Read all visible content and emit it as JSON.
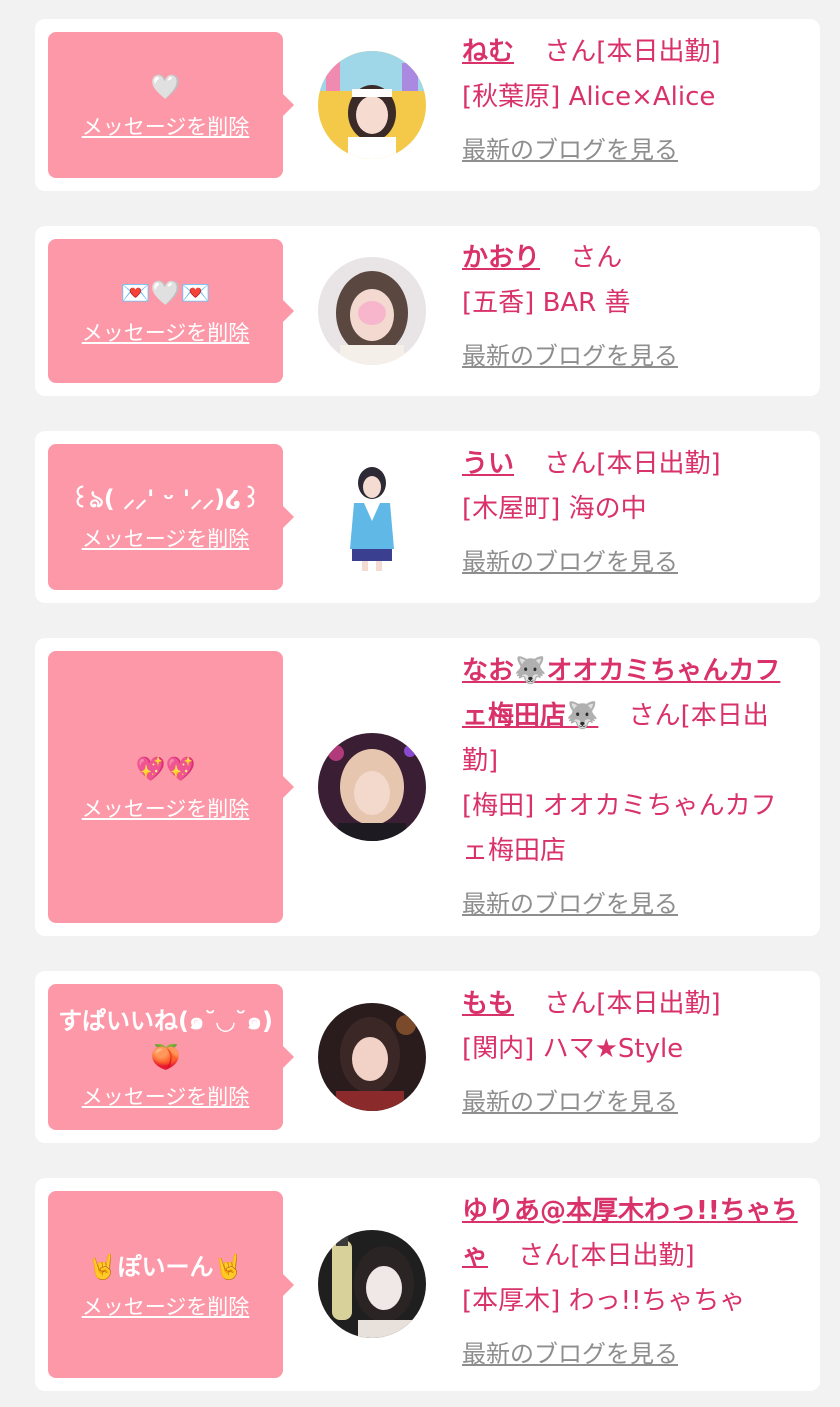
{
  "delete_label": "メッセージを削除",
  "blog_label": "最新のブログを見る",
  "san_label": "さん",
  "colors": {
    "page_bg": "#f2f2f2",
    "bubble": "#fd98a8",
    "accent": "#d9326a",
    "link_gray": "#8e8e8e"
  },
  "entries": [
    {
      "message": "🤍",
      "name": "ねむ",
      "today": "[本日出勤]",
      "area": "[秋葉原]",
      "shop": "Alice×Alice"
    },
    {
      "message": "💌🤍💌",
      "name": "かおり",
      "today": "",
      "area": "[五香]",
      "shop": "BAR 善"
    },
    {
      "message": "꒰ঌ( ⸝⸝' ᵕ '⸝⸝)໒꒱",
      "name": "うい",
      "today": "[本日出勤]",
      "area": "[木屋町]",
      "shop": "海の中"
    },
    {
      "message": "💖💖",
      "name": "なお🐺オオカミちゃんカフェ梅田店🐺",
      "today": "[本日出勤]",
      "area": "[梅田]",
      "shop": "オオカミちゃんカフェ梅田店"
    },
    {
      "message": "すぱいいね(๑˘◡˘๑)🍑",
      "name": "もも",
      "today": "[本日出勤]",
      "area": "[関内]",
      "shop": "ハマ★Style"
    },
    {
      "message": "🤘ぽいーん🤘",
      "name": "ゆりあ@本厚木わっ!!ちゃちゃ",
      "today": "[本日出勤]",
      "area": "[本厚木]",
      "shop": "わっ!!ちゃちゃ"
    }
  ]
}
